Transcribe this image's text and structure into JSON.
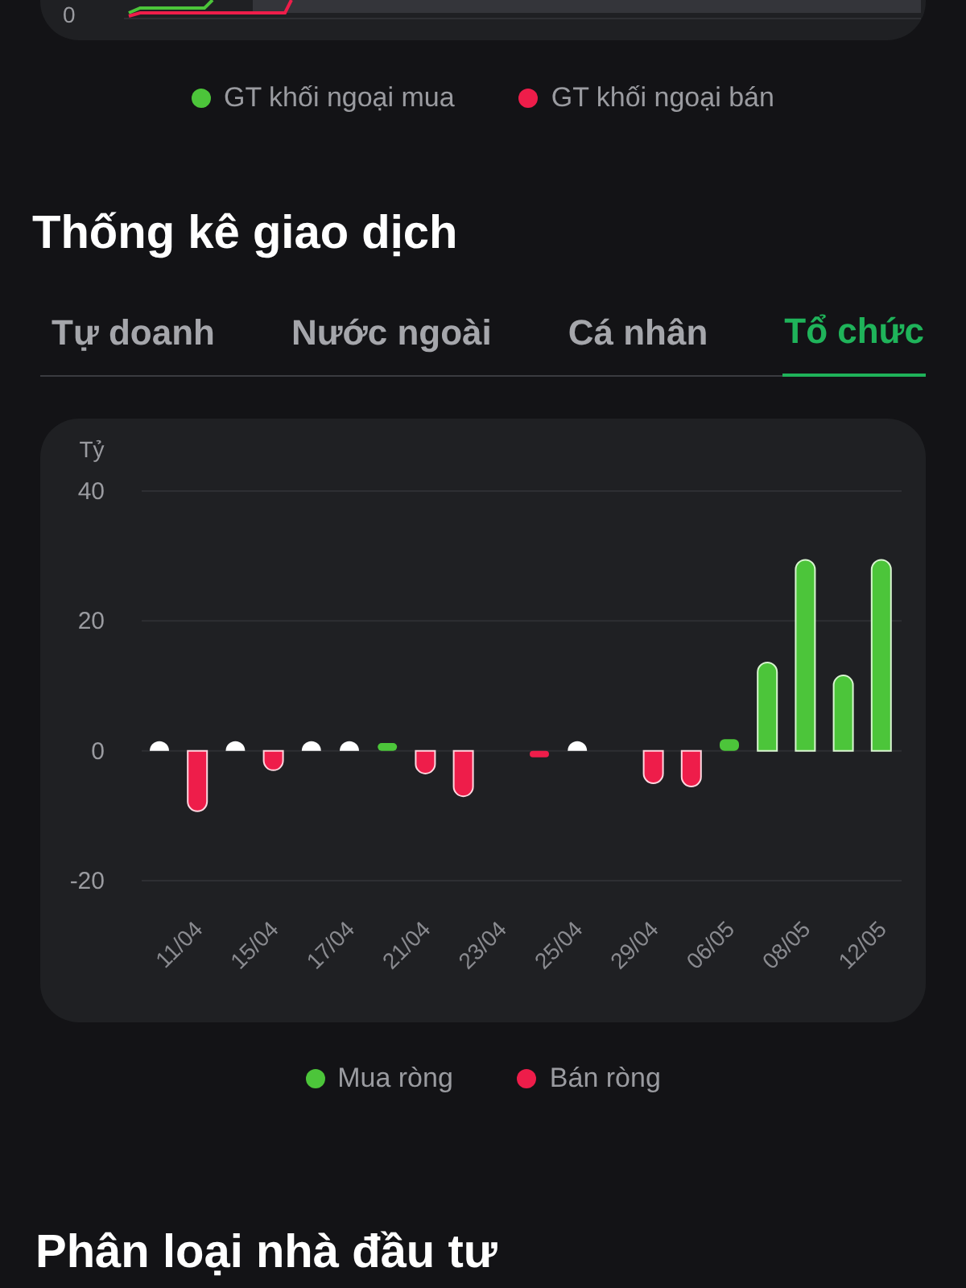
{
  "top_chart": {
    "axis_label": "0"
  },
  "top_legend": [
    {
      "label": "GT khối ngoại mua",
      "color": "#4cc53a"
    },
    {
      "label": "GT khối ngoại bán",
      "color": "#ee1d4a"
    }
  ],
  "section_title": "Thống kê giao dịch",
  "tabs": [
    {
      "label": "Tự doanh",
      "selected": false
    },
    {
      "label": "Nước ngoài",
      "selected": false
    },
    {
      "label": "Cá nhân",
      "selected": false
    },
    {
      "label": "Tổ chức",
      "selected": true
    }
  ],
  "chart_data": {
    "type": "bar",
    "ylabel": "Tỷ",
    "categories": [
      null,
      "11/04",
      null,
      "15/04",
      null,
      "17/04",
      null,
      "21/04",
      null,
      "23/04",
      null,
      "25/04",
      null,
      "29/04",
      null,
      "06/05",
      null,
      "08/05",
      null,
      "12/05"
    ],
    "yticks": [
      40,
      20,
      0,
      -20
    ],
    "ylim": [
      -20,
      40
    ],
    "grid": true,
    "series": [
      {
        "name": "Mua ròng",
        "color": "#4cc53a",
        "values": [
          0,
          null,
          0,
          null,
          0,
          0,
          1.2,
          null,
          null,
          null,
          null,
          0,
          null,
          null,
          null,
          1.8,
          13.6,
          29.4,
          11.6,
          29.4
        ]
      },
      {
        "name": "Bán ròng",
        "color": "#ee1d4a",
        "values": [
          null,
          -9.3,
          null,
          -3,
          null,
          null,
          null,
          -3.5,
          -7,
          null,
          -1,
          null,
          null,
          -5,
          -5.5,
          null,
          null,
          null,
          null,
          null
        ]
      }
    ]
  },
  "bottom_title": "Phân loại nhà đầu tư"
}
